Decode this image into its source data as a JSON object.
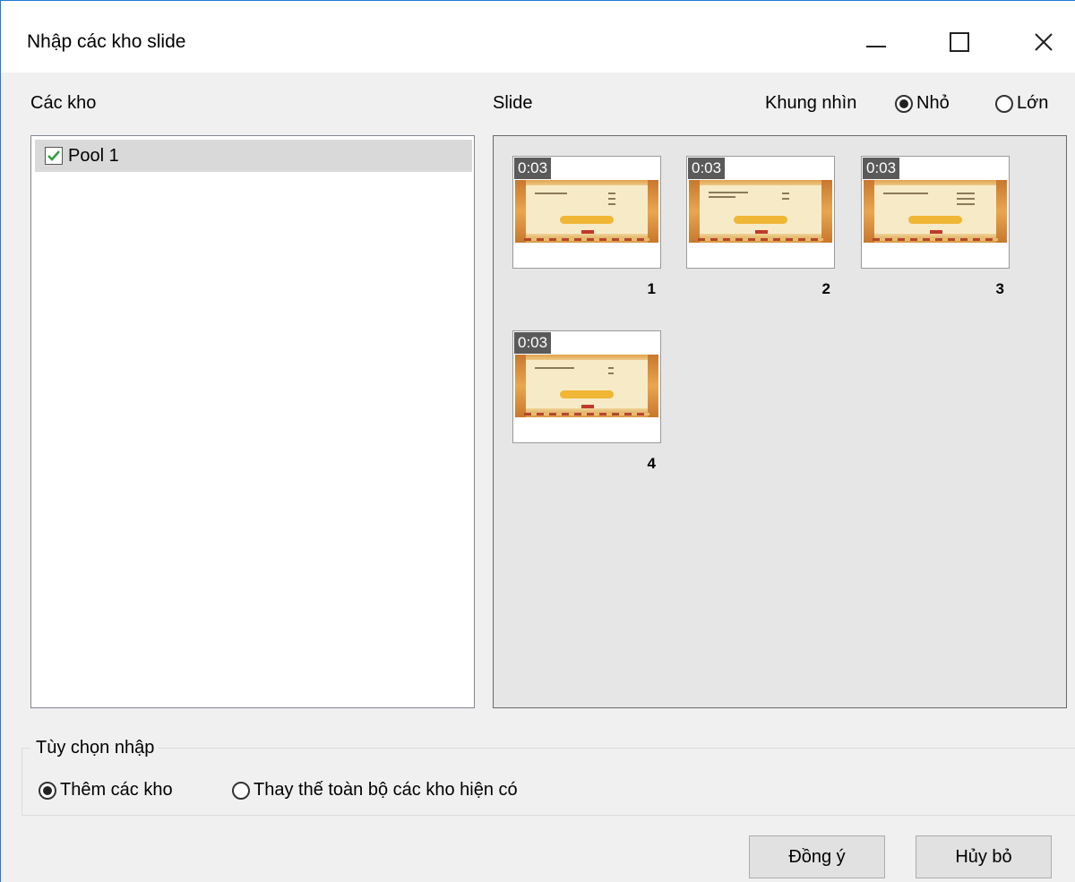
{
  "window": {
    "title": "Nhập các kho slide",
    "controls": [
      "minimize-icon",
      "maximize-icon",
      "close-icon"
    ]
  },
  "pools_panel": {
    "label": "Các kho",
    "items": [
      {
        "label": "Pool 1",
        "checked": true
      }
    ]
  },
  "slides_panel": {
    "label": "Slide",
    "view_label": "Khung nhìn",
    "view_options": [
      {
        "label": "Nhỏ",
        "selected": true
      },
      {
        "label": "Lớn",
        "selected": false
      }
    ],
    "slides": [
      {
        "number": "1",
        "duration": "0:03"
      },
      {
        "number": "2",
        "duration": "0:03"
      },
      {
        "number": "3",
        "duration": "0:03"
      },
      {
        "number": "4",
        "duration": "0:03"
      }
    ]
  },
  "import_options": {
    "group_title": "Tùy chọn nhập",
    "options": [
      {
        "label": "Thêm các kho",
        "selected": true
      },
      {
        "label": "Thay thế toàn bộ các kho hiện có",
        "selected": false
      }
    ]
  },
  "buttons": {
    "ok_label": "Đồng ý",
    "cancel_label": "Hủy bỏ"
  },
  "colors": {
    "window_border": "#1e7ad6",
    "dialog_bg": "#f0f0f0",
    "selected_row": "#d9d9d9",
    "checkmark": "#2e9e3e",
    "duration_badge": "#5a5a5a"
  }
}
